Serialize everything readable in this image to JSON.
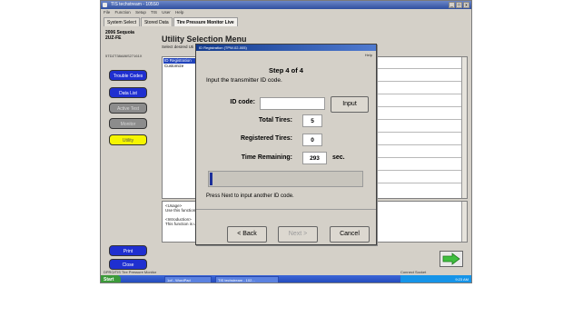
{
  "window": {
    "title": "TIS techstream - 105S0",
    "menu": [
      "File",
      "Function",
      "Setup",
      "TIS",
      "User",
      "Help"
    ],
    "controls": [
      "_",
      "□",
      "x"
    ]
  },
  "tabs": [
    "System Select",
    "Stored Data",
    "Tire Pressure Monitor Live"
  ],
  "vehicle": {
    "model": "2006 Sequoia",
    "engine": "2UZ-FE",
    "vin": "5TDZT38A86S27161X"
  },
  "sidebar": {
    "buttons": [
      "Trouble Codes",
      "Data List",
      "Active Test",
      "Monitor",
      "Utility"
    ],
    "print": "Print",
    "close": "Close"
  },
  "main": {
    "title": "Utility Selection Menu",
    "subtitle": "Select desired Uti",
    "items": [
      "ID Registration",
      "Customize"
    ],
    "info_lines": [
      "<Usage>",
      "Use this function",
      "",
      "<Introduction>",
      "This function is us"
    ]
  },
  "dialog": {
    "title": "ID Registration (TPW-02-005)",
    "help": "Help",
    "step": "Step 4 of 4",
    "prompt": "Input the transmitter ID code.",
    "id_code_label": "ID code:",
    "id_code_value": "",
    "input_button": "Input",
    "total_tires_label": "Total Tires:",
    "total_tires_value": "5",
    "registered_label": "Registered Tires:",
    "registered_value": "0",
    "time_label": "Time Remaining:",
    "time_value": "293",
    "time_unit": "sec.",
    "progress_fraction": 0.02,
    "note": "Press Next to input another ID code.",
    "back": "< Back",
    "next": "Next >",
    "cancel": "Cancel"
  },
  "status_bar": {
    "left": "DPRO/TIS Tire Pressure Monitor",
    "right": "Connect Socket"
  },
  "taskbar": {
    "start": "Start",
    "tasks": [
      "1of - WordPad",
      "TIS techstream - 102..."
    ],
    "clock": "9:23 AM"
  },
  "colors": {
    "button_blue": "#1f2fd0",
    "utility_yellow": "#f5f500",
    "title_blue": "#2f4f9f",
    "progress": "#1c2f9a"
  }
}
